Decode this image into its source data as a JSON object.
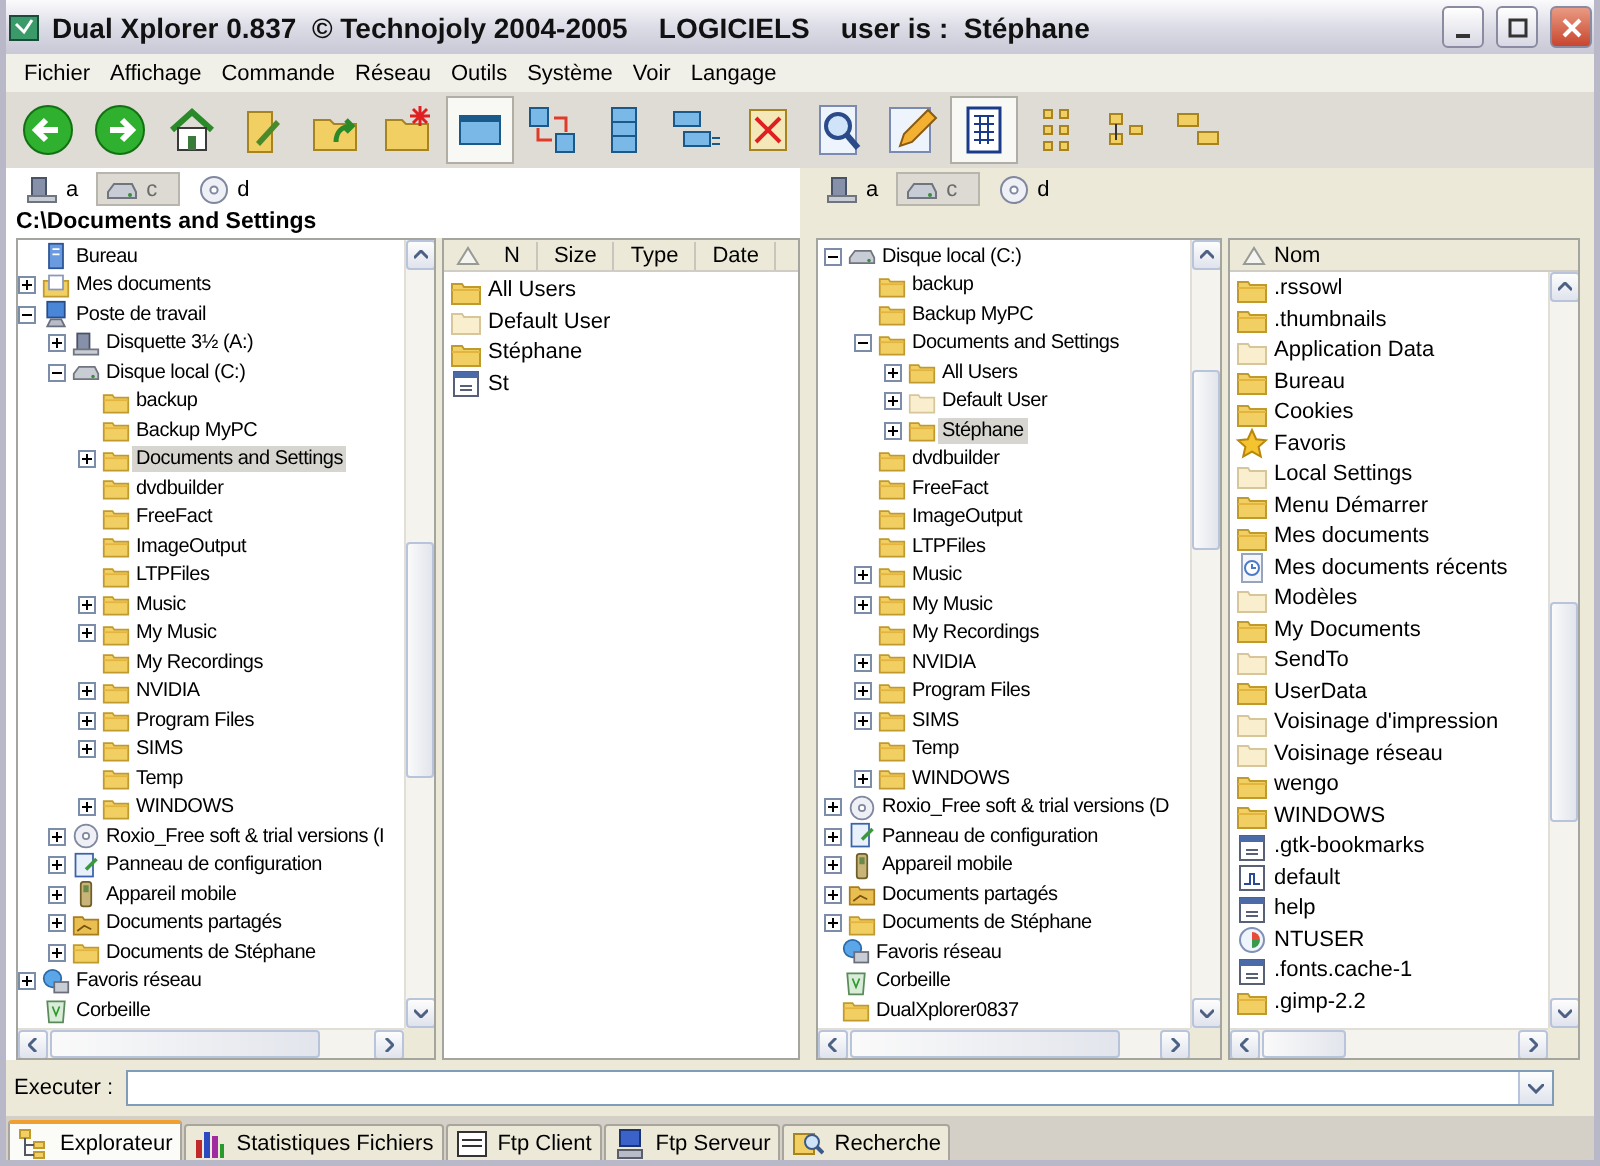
{
  "window": {
    "title": "Dual Xplorer 0.837  © Technojoly 2004-2005    LOGICIELS    user is :  Stéphane"
  },
  "menu": [
    "Fichier",
    "Affichage",
    "Commande",
    "Réseau",
    "Outils",
    "Système",
    "Voir",
    "Langage"
  ],
  "toolbar": [
    {
      "kind": "back",
      "pressed": false
    },
    {
      "kind": "forward",
      "pressed": false
    },
    {
      "kind": "home",
      "pressed": false
    },
    {
      "kind": "folder-edit",
      "pressed": false
    },
    {
      "kind": "folder-up",
      "pressed": false
    },
    {
      "kind": "folder-new",
      "pressed": false
    },
    {
      "kind": "window",
      "pressed": true
    },
    {
      "kind": "swap",
      "pressed": false
    },
    {
      "kind": "columns",
      "pressed": false
    },
    {
      "kind": "rows",
      "pressed": false
    },
    {
      "kind": "no-delete",
      "pressed": false
    },
    {
      "kind": "search",
      "pressed": false
    },
    {
      "kind": "edit",
      "pressed": false
    },
    {
      "kind": "grid",
      "pressed": true
    },
    {
      "kind": "icons-large",
      "pressed": false
    },
    {
      "kind": "icons-small",
      "pressed": false
    },
    {
      "kind": "details",
      "pressed": false
    }
  ],
  "left_pane": {
    "drives": [
      {
        "letter": "a",
        "kind": "floppy",
        "selected": false
      },
      {
        "letter": "c",
        "kind": "drive",
        "selected": true
      },
      {
        "letter": "d",
        "kind": "cd",
        "selected": false
      }
    ],
    "path": "C:\\Documents and Settings",
    "tree": {
      "items": [
        {
          "label": "Bureau",
          "kind": "desktop",
          "selected": false
        },
        {
          "label": "Mes documents",
          "kind": "documents",
          "expanded": false,
          "selected": false
        },
        {
          "label": "Poste de travail",
          "kind": "computer",
          "expanded": true,
          "selected": false,
          "children": [
            {
              "label": "Disquette 3½ (A:)",
              "kind": "floppy",
              "expanded": false,
              "selected": false
            },
            {
              "label": "Disque local (C:)",
              "kind": "drive",
              "expanded": true,
              "selected": false,
              "children": [
                {
                  "label": "backup",
                  "kind": "folder",
                  "selected": false
                },
                {
                  "label": "Backup MyPC",
                  "kind": "folder",
                  "selected": false
                },
                {
                  "label": "Documents and Settings",
                  "kind": "folder",
                  "expanded": false,
                  "selected": true
                },
                {
                  "label": "dvdbuilder",
                  "kind": "folder",
                  "selected": false
                },
                {
                  "label": "FreeFact",
                  "kind": "folder",
                  "selected": false
                },
                {
                  "label": "ImageOutput",
                  "kind": "folder",
                  "selected": false
                },
                {
                  "label": "LTPFiles",
                  "kind": "folder",
                  "selected": false
                },
                {
                  "label": "Music",
                  "kind": "folder",
                  "expanded": false,
                  "selected": false
                },
                {
                  "label": "My Music",
                  "kind": "folder",
                  "expanded": false,
                  "selected": false
                },
                {
                  "label": "My Recordings",
                  "kind": "folder",
                  "selected": false
                },
                {
                  "label": "NVIDIA",
                  "kind": "folder",
                  "expanded": false,
                  "selected": false
                },
                {
                  "label": "Program Files",
                  "kind": "folder",
                  "expanded": false,
                  "selected": false
                },
                {
                  "label": "SIMS",
                  "kind": "folder",
                  "expanded": false,
                  "selected": false
                },
                {
                  "label": "Temp",
                  "kind": "folder",
                  "selected": false
                },
                {
                  "label": "WINDOWS",
                  "kind": "folder",
                  "expanded": false,
                  "selected": false
                }
              ]
            },
            {
              "label": "Roxio_Free soft & trial versions (I",
              "kind": "cd",
              "expanded": false,
              "selected": false
            },
            {
              "label": "Panneau de configuration",
              "kind": "control-panel",
              "expanded": false,
              "selected": false
            },
            {
              "label": "Appareil mobile",
              "kind": "mobile",
              "expanded": false,
              "selected": false
            },
            {
              "label": "Documents partagés",
              "kind": "shared-folder",
              "expanded": false,
              "selected": false
            },
            {
              "label": "Documents de Stéphane",
              "kind": "folder",
              "expanded": false,
              "selected": false
            }
          ]
        },
        {
          "label": "Favoris réseau",
          "kind": "network",
          "expanded": false,
          "selected": false
        },
        {
          "label": "Corbeille",
          "kind": "recycle",
          "selected": false
        }
      ]
    },
    "files": {
      "columns": [
        "N",
        "Size",
        "Type",
        "Date"
      ],
      "items": [
        {
          "name": "All Users",
          "kind": "folder",
          "selected": false
        },
        {
          "name": "Default User",
          "kind": "folder-pale",
          "selected": false
        },
        {
          "name": "Stéphane",
          "kind": "folder",
          "selected": false
        },
        {
          "name": "St",
          "kind": "file",
          "selected": false
        }
      ]
    }
  },
  "right_pane": {
    "drives": [
      {
        "letter": "a",
        "kind": "floppy",
        "selected": false
      },
      {
        "letter": "c",
        "kind": "drive",
        "selected": true
      },
      {
        "letter": "d",
        "kind": "cd",
        "selected": false
      }
    ],
    "tree": {
      "continued_branch": [
        {
          "label": "Disque local (C:)",
          "kind": "drive",
          "expanded": true,
          "selected": false,
          "children": [
            {
              "label": "backup",
              "kind": "folder",
              "selected": false
            },
            {
              "label": "Backup MyPC",
              "kind": "folder",
              "selected": false
            },
            {
              "label": "Documents and Settings",
              "kind": "folder",
              "expanded": true,
              "selected": false,
              "children": [
                {
                  "label": "All Users",
                  "kind": "folder",
                  "expanded": false,
                  "selected": false
                },
                {
                  "label": "Default User",
                  "kind": "folder-pale",
                  "expanded": false,
                  "selected": false
                },
                {
                  "label": "Stéphane",
                  "kind": "folder",
                  "expanded": false,
                  "selected": true
                }
              ]
            },
            {
              "label": "dvdbuilder",
              "kind": "folder",
              "selected": false
            },
            {
              "label": "FreeFact",
              "kind": "folder",
              "selected": false
            },
            {
              "label": "ImageOutput",
              "kind": "folder",
              "selected": false
            },
            {
              "label": "LTPFiles",
              "kind": "folder",
              "selected": false
            },
            {
              "label": "Music",
              "kind": "folder",
              "expanded": false,
              "selected": false
            },
            {
              "label": "My Music",
              "kind": "folder",
              "expanded": false,
              "selected": false
            },
            {
              "label": "My Recordings",
              "kind": "folder",
              "selected": false
            },
            {
              "label": "NVIDIA",
              "kind": "folder",
              "expanded": false,
              "selected": false
            },
            {
              "label": "Program Files",
              "kind": "folder",
              "expanded": false,
              "selected": false
            },
            {
              "label": "SIMS",
              "kind": "folder",
              "expanded": false,
              "selected": false
            },
            {
              "label": "Temp",
              "kind": "folder",
              "selected": false
            },
            {
              "label": "WINDOWS",
              "kind": "folder",
              "expanded": false,
              "selected": false
            }
          ]
        },
        {
          "label": "Roxio_Free soft & trial versions (D",
          "kind": "cd",
          "expanded": false,
          "selected": false
        },
        {
          "label": "Panneau de configuration",
          "kind": "control-panel",
          "expanded": false,
          "selected": false
        },
        {
          "label": "Appareil mobile",
          "kind": "mobile",
          "expanded": false,
          "selected": false
        },
        {
          "label": "Documents partagés",
          "kind": "shared-folder",
          "expanded": false,
          "selected": false
        },
        {
          "label": "Documents de Stéphane",
          "kind": "folder",
          "expanded": false,
          "selected": false
        }
      ],
      "items": [
        {
          "label": "Favoris réseau",
          "kind": "network",
          "selected": false
        },
        {
          "label": "Corbeille",
          "kind": "recycle",
          "selected": false
        },
        {
          "label": "DualXplorer0837",
          "kind": "folder",
          "selected": false
        }
      ]
    },
    "files": {
      "columns": [
        "Nom"
      ],
      "items": [
        {
          "name": ".rssowl",
          "kind": "folder",
          "selected": false
        },
        {
          "name": ".thumbnails",
          "kind": "folder",
          "selected": false
        },
        {
          "name": "Application Data",
          "kind": "folder-pale",
          "selected": false
        },
        {
          "name": "Bureau",
          "kind": "folder",
          "selected": false
        },
        {
          "name": "Cookies",
          "kind": "folder",
          "selected": false
        },
        {
          "name": "Favoris",
          "kind": "star",
          "selected": false
        },
        {
          "name": "Local Settings",
          "kind": "folder-pale",
          "selected": false
        },
        {
          "name": "Menu Démarrer",
          "kind": "folder",
          "selected": false
        },
        {
          "name": "Mes documents",
          "kind": "folder",
          "selected": false
        },
        {
          "name": "Mes documents récents",
          "kind": "recent",
          "selected": false
        },
        {
          "name": "Modèles",
          "kind": "folder-pale",
          "selected": false
        },
        {
          "name": "My Documents",
          "kind": "folder",
          "selected": false
        },
        {
          "name": "SendTo",
          "kind": "folder-pale",
          "selected": false
        },
        {
          "name": "UserData",
          "kind": "folder",
          "selected": false
        },
        {
          "name": "Voisinage d'impression",
          "kind": "folder-pale",
          "selected": false
        },
        {
          "name": "Voisinage réseau",
          "kind": "folder-pale",
          "selected": false
        },
        {
          "name": "wengo",
          "kind": "folder",
          "selected": false
        },
        {
          "name": "WINDOWS",
          "kind": "folder",
          "selected": false
        },
        {
          "name": ".gtk-bookmarks",
          "kind": "file",
          "selected": false
        },
        {
          "name": "default",
          "kind": "script",
          "selected": false
        },
        {
          "name": "help",
          "kind": "file",
          "selected": false
        },
        {
          "name": "NTUSER",
          "kind": "system",
          "selected": false
        },
        {
          "name": ".fonts.cache-1",
          "kind": "file",
          "selected": false
        },
        {
          "name": ".gimp-2.2",
          "kind": "folder",
          "selected": false
        }
      ]
    }
  },
  "command_bar": {
    "label": "Executer :"
  },
  "tabs": [
    {
      "label": "Explorateur",
      "kind": "tree",
      "selected": true
    },
    {
      "label": "Statistiques Fichiers",
      "kind": "chart",
      "selected": false
    },
    {
      "label": "Ftp Client",
      "kind": "ftp",
      "selected": false
    },
    {
      "label": "Ftp Serveur",
      "kind": "server",
      "selected": false
    },
    {
      "label": "Recherche",
      "kind": "search",
      "selected": false
    }
  ]
}
